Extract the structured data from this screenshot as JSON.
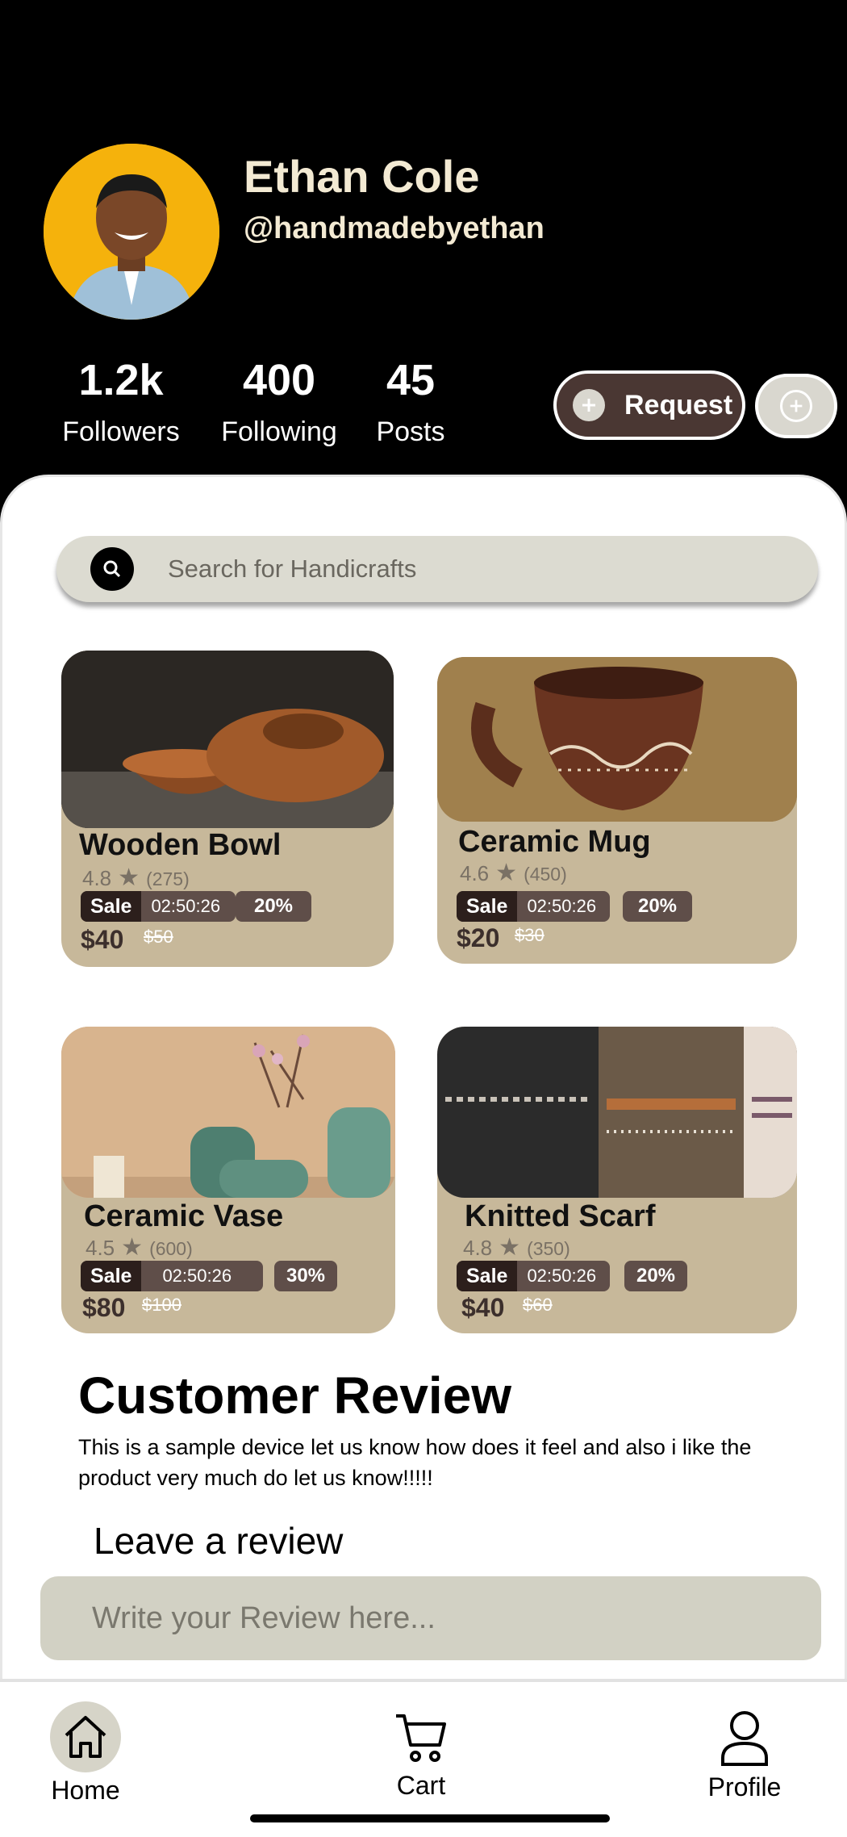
{
  "profile": {
    "name": "Ethan Cole",
    "handle": "@handmadebyethan",
    "avatar_bg": "#f5b20c",
    "stats": [
      {
        "value": "1.2k",
        "label": "Followers"
      },
      {
        "value": "400",
        "label": "Following"
      },
      {
        "value": "45",
        "label": "Posts"
      }
    ],
    "request_button": "Request"
  },
  "search": {
    "placeholder": "Search for Handicrafts"
  },
  "products": [
    {
      "title": "Wooden Bowl",
      "rating": "4.8",
      "reviews": "(275)",
      "sale_label": "Sale",
      "timer": "02:50:26",
      "discount": "20%",
      "price": "$40",
      "old_price": "$50"
    },
    {
      "title": "Ceramic Mug",
      "rating": "4.6",
      "reviews": "(450)",
      "sale_label": "Sale",
      "timer": "02:50:26",
      "discount": "20%",
      "price": "$20",
      "old_price": "$30"
    },
    {
      "title": "Ceramic Vase",
      "rating": "4.5",
      "reviews": "(600)",
      "sale_label": "Sale",
      "timer": "02:50:26",
      "discount": "30%",
      "price": "$80",
      "old_price": "$100"
    },
    {
      "title": "Knitted Scarf",
      "rating": "4.8",
      "reviews": "(350)",
      "sale_label": "Sale",
      "timer": "02:50:26",
      "discount": "20%",
      "price": "$40",
      "old_price": "$60"
    }
  ],
  "review_section": {
    "title": "Customer Review",
    "text": "This is a sample device let us know how does it feel and also i like the product very much do let us know!!!!!",
    "leave_title": "Leave a review",
    "input_placeholder": "Write your Review here..."
  },
  "nav": {
    "home": "Home",
    "cart": "Cart",
    "profile": "Profile"
  },
  "colors": {
    "card_bg": "#c7b89a",
    "tag_bg": "#5f4e49",
    "button_bg": "#4a3733",
    "search_bg": "#dcdbd1"
  }
}
